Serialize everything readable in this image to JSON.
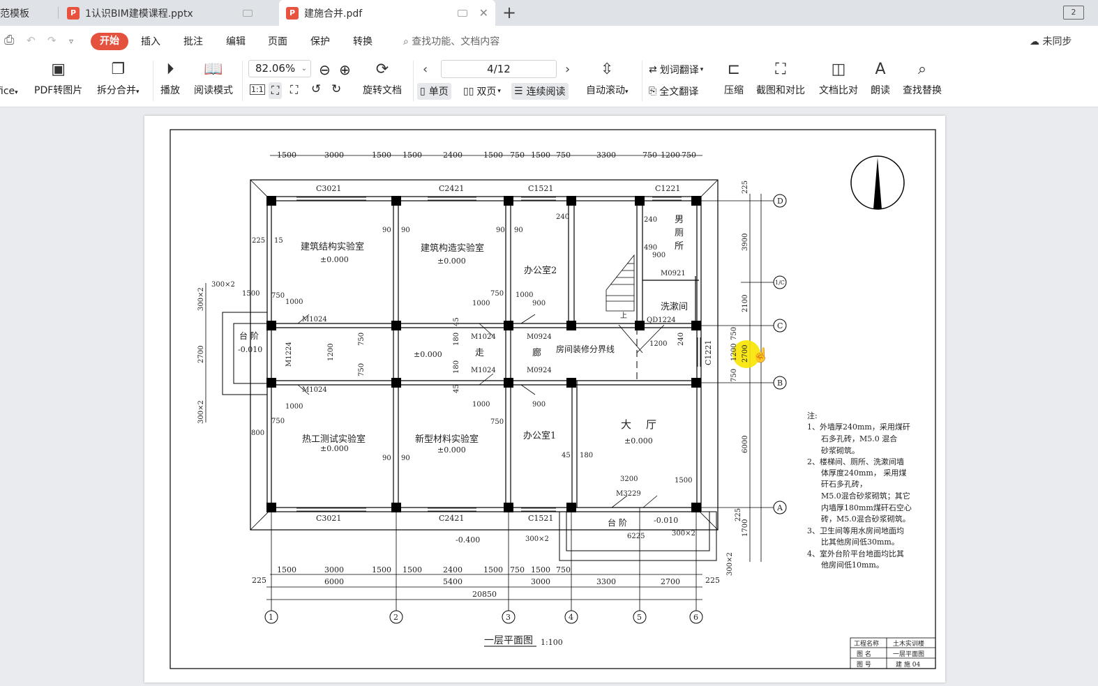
{
  "tabs": [
    {
      "label": "范模板"
    },
    {
      "label": "1认识BIM建模课程.pptx"
    },
    {
      "label": "建施合并.pdf"
    }
  ],
  "window": {
    "restore_label": "2"
  },
  "menu": {
    "start": "开始",
    "items": [
      "插入",
      "批注",
      "编辑",
      "页面",
      "保护",
      "转换"
    ],
    "search_placeholder": "查找功能、文档内容",
    "sync": "未同步"
  },
  "ribbon": {
    "office": "fice",
    "pdf_to_image": "PDF转图片",
    "split_merge": "拆分合并",
    "play": "播放",
    "read_mode": "阅读模式",
    "zoom": "82.06%",
    "rotate": "旋转文档",
    "page_indicator": "4/12",
    "single": "单页",
    "double": "双页",
    "continuous": "连续阅读",
    "auto_scroll": "自动滚动",
    "word_translate": "划词翻译",
    "full_translate": "全文翻译",
    "compress": "压缩",
    "screenshot_compare": "截图和对比",
    "doc_compare": "文档比对",
    "read_aloud": "朗读",
    "find_replace": "查找替换"
  },
  "drawing": {
    "title": "一层平面图",
    "scale": "1:100",
    "rooms": {
      "r1": "建筑结构实验室",
      "r2": "建筑构造实验室",
      "r3": "办公室2",
      "r4": "男",
      "r4b": "厕",
      "r4c": "所",
      "r5": "洗漱间",
      "r6": "热工测试实验室",
      "r7": "新型材料实验室",
      "r8": "办公室1",
      "r9": "大",
      "r9b": "厅",
      "corridor1": "走",
      "corridor2": "廊",
      "steps1": "台 阶",
      "steps2": "台  阶",
      "boundary": "房间装修分界线",
      "stair_up": "上"
    },
    "elevations": {
      "zero": "±0.000",
      "step1": "-0.010",
      "step2": "-0.010",
      "outside": "-0.400"
    },
    "top_dims": [
      "1500",
      "3000",
      "1500",
      "1500",
      "2400",
      "1500",
      "750",
      "1500",
      "750",
      "3300",
      "750",
      "1200",
      "750"
    ],
    "bottom_dims1": [
      "1500",
      "3000",
      "1500",
      "1500",
      "2400",
      "1500",
      "750",
      "1500",
      "750"
    ],
    "bottom_dims2": [
      "6000",
      "5400",
      "3000",
      "3300",
      "2700"
    ],
    "total": "20850",
    "edge_dims": {
      "left": "225",
      "right": "225"
    },
    "windows": [
      "C3021",
      "C2421",
      "C1521",
      "C1221",
      "C3021",
      "C2421",
      "C1521",
      "C1221"
    ],
    "doors": [
      "M1024",
      "M1024",
      "M0924",
      "M1024",
      "M0924",
      "M1024",
      "M1224",
      "M0921",
      "M3229",
      "QD1224"
    ],
    "axes_x": [
      "1",
      "2",
      "3",
      "4",
      "5",
      "6"
    ],
    "axes_y": [
      "D",
      "1/C",
      "C",
      "B",
      "A"
    ],
    "right_dims": [
      "225",
      "3900",
      "2100",
      "750",
      "1200",
      "750",
      "6000",
      "225",
      "1700",
      "300×2"
    ],
    "right_dim_mid": "2700",
    "left_dims": [
      "300×2",
      "2700",
      "300×2"
    ],
    "misc_dims": {
      "d225": "225",
      "d15": "15",
      "d90a": "90",
      "d90b": "90",
      "d90c": "90",
      "d90d": "90",
      "d90e": "90",
      "d90f": "90",
      "d240a": "240",
      "d240b": "240",
      "d240c": "240",
      "d490": "490",
      "d900a": "900",
      "d900b": "900",
      "d900c": "900",
      "d1000a": "1000",
      "d1000b": "1000",
      "d1000c": "1000",
      "d1000d": "1000",
      "d1000e": "1000",
      "d750a": "750",
      "d750b": "750",
      "d750c": "750",
      "d750d": "750",
      "d750e": "750",
      "d750f": "750",
      "d1500": "1500",
      "d300x2a": "300×2",
      "d1200a": "1200",
      "d1200b": "1200",
      "d45a": "45",
      "d45b": "45",
      "d180a": "180",
      "d180b": "180",
      "d180c": "180",
      "d800": "800",
      "d3200": "3200",
      "d1500b": "1500",
      "d6225": "6225",
      "d300x2b": "300×2",
      "d300x2c": "300×2"
    },
    "notes_title": "注:",
    "notes": [
      "1、外墙厚240mm，采用煤矸",
      "石多孔砖，M5.0   混合",
      "砂浆砌筑。",
      "2、楼梯间、厕所、洗漱间墙",
      "体厚度240mm，   采用煤",
      "矸石多孔砖，",
      "M5.0混合砂浆砌筑；其它",
      "内墙厚180mm煤矸石空心",
      "砖，M5.0混合砂浆砌筑。",
      "3、卫生间等用水房间地面均",
      "比其他房间低30mm。",
      "4、室外台阶平台地面均比其",
      "他房间低10mm。"
    ],
    "titleblock": {
      "k1": "工程名称",
      "v1": "土木实训楼",
      "k2": "图  名",
      "v2": "一层平面图",
      "k3": "图  号",
      "v3": "建 施 04"
    }
  },
  "colors": {
    "accent": "#e4513f",
    "highlight": "#f7e600"
  }
}
